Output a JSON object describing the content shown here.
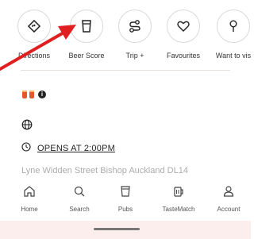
{
  "actions": [
    {
      "label": "Directions",
      "icon": "directions-icon"
    },
    {
      "label": "Beer Score",
      "icon": "beer-glass-icon"
    },
    {
      "label": "Trip +",
      "icon": "route-icon"
    },
    {
      "label": "Favourites",
      "icon": "heart-icon"
    },
    {
      "label": "Want to vis",
      "icon": "location-pin-icon"
    }
  ],
  "details": {
    "badges": [
      "pint-icon",
      "pint-icon",
      "info-icon"
    ],
    "info_symbol": "i",
    "opening": "OPENS AT 2:00PM",
    "address_cut": "Lyne Widden Street Bishop Auckland DL14"
  },
  "tabbar": [
    {
      "label": "Home",
      "icon": "home-icon"
    },
    {
      "label": "Search",
      "icon": "search-icon"
    },
    {
      "label": "Pubs",
      "icon": "pub-glass-icon"
    },
    {
      "label": "TasteMatch",
      "icon": "beer-mug-icon"
    },
    {
      "label": "Account",
      "icon": "account-icon"
    }
  ],
  "colors": {
    "annotation_arrow": "#e02020",
    "accent": "#e2572d",
    "bottom_bar": "#fbeeed"
  }
}
